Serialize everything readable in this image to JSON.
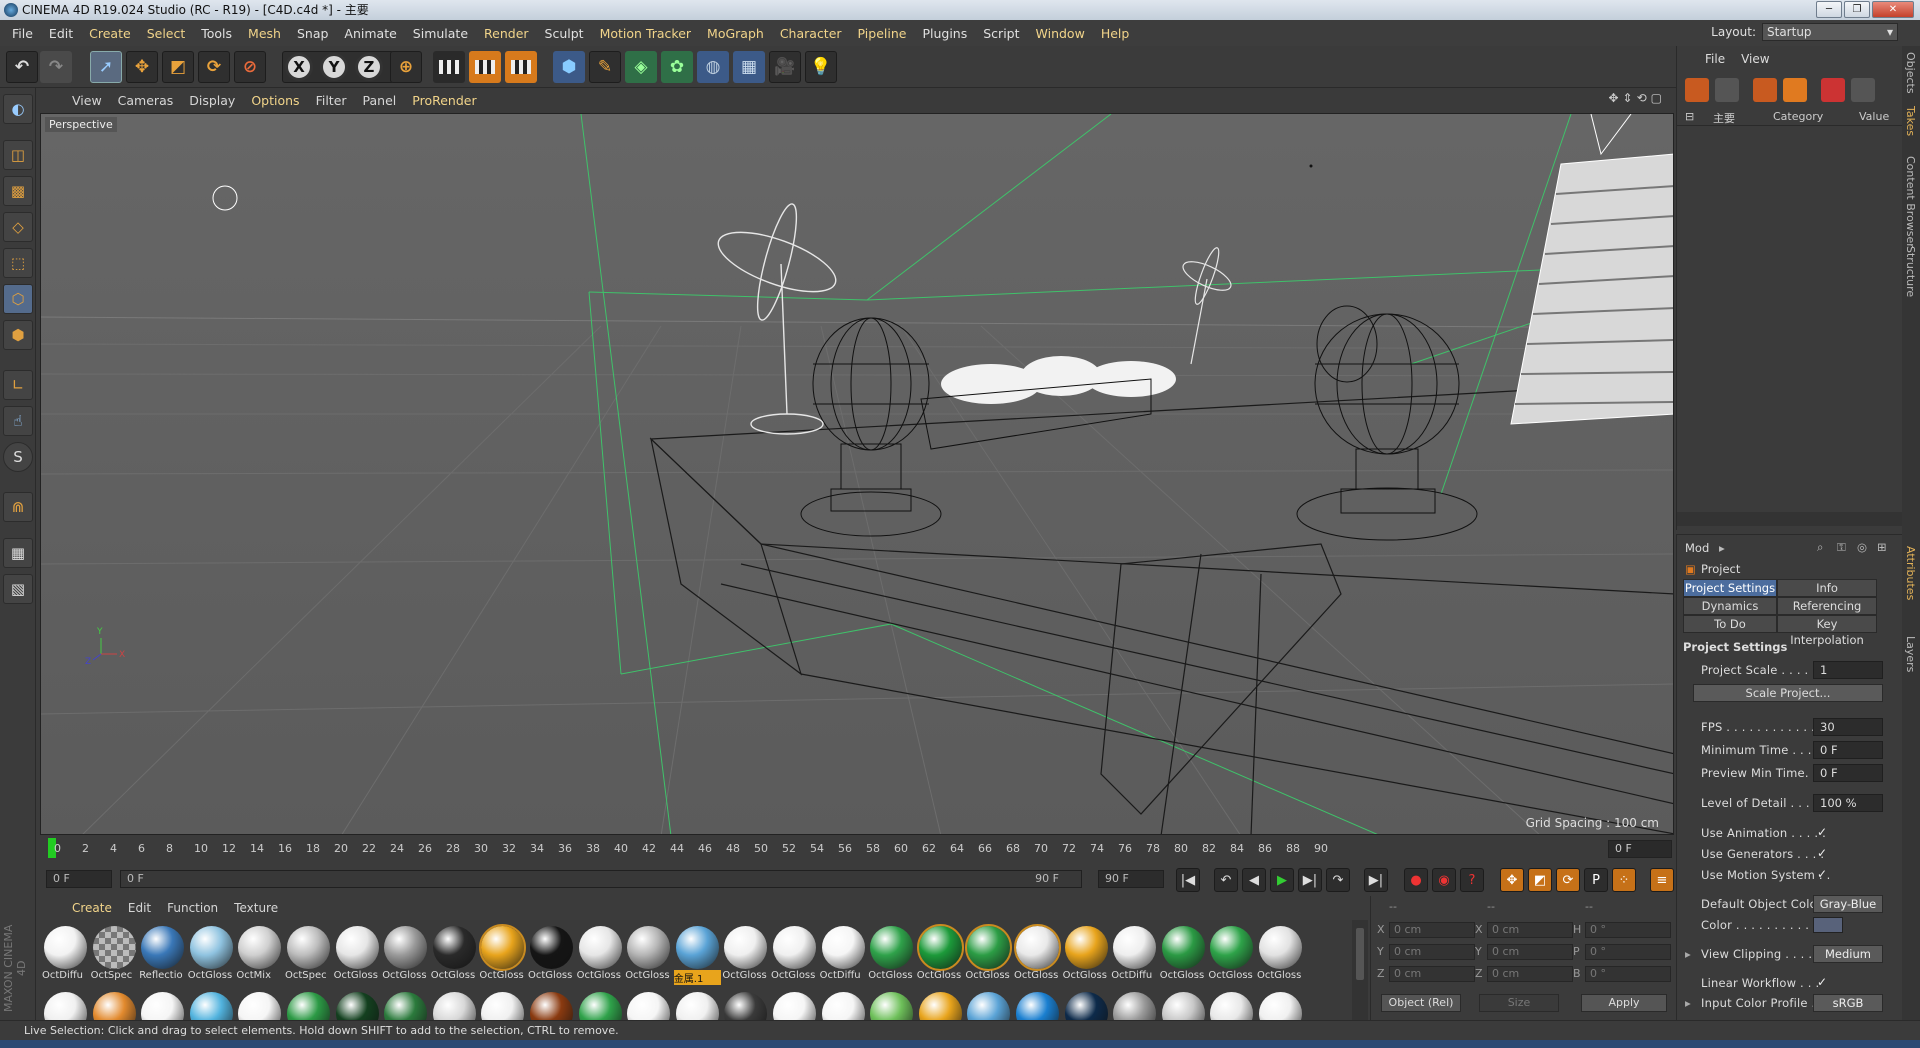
{
  "window": {
    "title": "CINEMA 4D R19.024 Studio (RC - R19) - [C4D.c4d *] - 主要"
  },
  "menu": [
    "File",
    "Edit",
    "Create",
    "Select",
    "Tools",
    "Mesh",
    "Snap",
    "Animate",
    "Simulate",
    "Render",
    "Sculpt",
    "Motion Tracker",
    "MoGraph",
    "Character",
    "Pipeline",
    "Plugins",
    "Script",
    "Window",
    "Help"
  ],
  "layout": {
    "label": "Layout:",
    "value": "Startup"
  },
  "viewport_menu": [
    "View",
    "Cameras",
    "Display",
    "Options",
    "Filter",
    "Panel",
    "ProRender"
  ],
  "viewport": {
    "camera": "Perspective",
    "grid_spacing": "Grid Spacing : 100 cm"
  },
  "timeline": {
    "ticks": [
      "0",
      "2",
      "4",
      "6",
      "8",
      "10",
      "12",
      "14",
      "16",
      "18",
      "20",
      "22",
      "24",
      "26",
      "28",
      "30",
      "32",
      "34",
      "36",
      "38",
      "40",
      "42",
      "44",
      "46",
      "48",
      "50",
      "52",
      "54",
      "56",
      "58",
      "60",
      "62",
      "64",
      "66",
      "68",
      "70",
      "72",
      "74",
      "76",
      "78",
      "80",
      "82",
      "84",
      "86",
      "88",
      "90"
    ],
    "current_frame": "0 F",
    "start": "0 F",
    "range_start": "0 F",
    "range_end": "90 F",
    "end": "90 F"
  },
  "material_menu": [
    "Create",
    "Edit",
    "Function",
    "Texture"
  ],
  "materials_row1": [
    {
      "name": "OctDiffu",
      "color": "#f2f2f2"
    },
    {
      "name": "OctSpec",
      "color": "checker"
    },
    {
      "name": "Reflectio",
      "color": "#3a78b8"
    },
    {
      "name": "OctGloss",
      "color": "#8fc3e0"
    },
    {
      "name": "OctMix",
      "color": "#cfcfcf"
    },
    {
      "name": "OctSpec",
      "color": "#bdbdbd"
    },
    {
      "name": "OctGloss",
      "color": "#e6e6e6"
    },
    {
      "name": "OctGloss",
      "color": "#9a9a9a"
    },
    {
      "name": "OctGloss",
      "color": "#2a2a2a"
    },
    {
      "name": "OctGloss",
      "color": "#e8a41c"
    },
    {
      "name": "OctGloss",
      "color": "#151515"
    },
    {
      "name": "OctGloss",
      "color": "#e6e6e6"
    },
    {
      "name": "OctGloss",
      "color": "#b5b5b5"
    },
    {
      "name": "金属.1",
      "color": "#5aa3d6",
      "tag": true
    },
    {
      "name": "OctGloss",
      "color": "#efefef"
    },
    {
      "name": "OctGloss",
      "color": "#f0f0f0"
    },
    {
      "name": "OctDiffu",
      "color": "#f5f5f5"
    },
    {
      "name": "OctGloss",
      "color": "#2fa24a"
    },
    {
      "name": "OctGloss",
      "color": "#1c9a3a"
    },
    {
      "name": "OctGloss",
      "color": "#2c9d45"
    },
    {
      "name": "OctGloss",
      "color": "#e9e9e9"
    },
    {
      "name": "OctGloss",
      "color": "#e8a41c"
    },
    {
      "name": "OctDiffu",
      "color": "#eeeeee"
    },
    {
      "name": "OctGloss",
      "color": "#2b9a44"
    },
    {
      "name": "OctGloss",
      "color": "#2ea349"
    },
    {
      "name": "OctGloss",
      "color": "#e2e2e2"
    }
  ],
  "materials_row2": [
    "#f0f0f0",
    "#e28a2e",
    "#f5f5f5",
    "#52b3de",
    "#f5f5f5",
    "#2c9a45",
    "#13401f",
    "#2b7a3c",
    "#d8d8d8",
    "#f0f0f0",
    "#8a3a10",
    "#2fa24a",
    "#f5f5f5",
    "#f0f0f0",
    "#3a3a3a",
    "#f5f5f5",
    "#f5f5f5",
    "#6ec05a",
    "#e8a41c",
    "#5aa3d6",
    "#1a7fd0",
    "#0d2a4a",
    "#9a9a9a",
    "#c8c8c8",
    "#e8e8e8",
    "#f0f0f0"
  ],
  "coords": {
    "header": [
      "--",
      "--",
      "--"
    ],
    "rows": [
      {
        "a": "X",
        "av": "0 cm",
        "b": "X",
        "bv": "0 cm",
        "c": "H",
        "cv": "0 °"
      },
      {
        "a": "Y",
        "av": "0 cm",
        "b": "Y",
        "bv": "0 cm",
        "c": "P",
        "cv": "0 °"
      },
      {
        "a": "Z",
        "av": "0 cm",
        "b": "Z",
        "bv": "0 cm",
        "c": "B",
        "cv": "0 °"
      }
    ],
    "mode": "Object (Rel)",
    "size": "Size",
    "apply": "Apply"
  },
  "status": "Live Selection: Click and drag to select elements. Hold down SHIFT to add to the selection, CTRL to remove.",
  "object_panel": {
    "menu": [
      "File",
      "View"
    ],
    "take": "主要",
    "col_category": "Category",
    "col_value": "Value"
  },
  "attributes": {
    "mode": "Mod",
    "object": "Project",
    "tabs": [
      "Project Settings",
      "Info",
      "Dynamics",
      "Referencing",
      "To Do",
      "Key Interpolation"
    ],
    "section": "Project Settings",
    "project_scale": {
      "label": "Project Scale . . . . . .",
      "value": "1"
    },
    "scale_button": "Scale Project...",
    "fps": {
      "label": "FPS . . . . . . . . . . . . . . .",
      "value": "30"
    },
    "min_time": {
      "label": "Minimum Time . . . .",
      "value": "0 F"
    },
    "preview_min": {
      "label": "Preview Min Time. . .",
      "value": "0 F"
    },
    "lod": {
      "label": "Level of Detail . . . . .",
      "value": "100 %"
    },
    "use_animation": {
      "label": "Use Animation . . . . .",
      "value": "✓"
    },
    "use_generators": {
      "label": "Use Generators . . . .",
      "value": "✓"
    },
    "use_motion": {
      "label": "Use Motion System . .",
      "value": "✓"
    },
    "default_color": {
      "label": "Default Object Color",
      "value": "Gray-Blue"
    },
    "color": {
      "label": "Color . . . . . . . . . . . ."
    },
    "view_clipping": {
      "label": "View Clipping . . . . .",
      "value": "Medium"
    },
    "linear_workflow": {
      "label": "Linear Workflow . . .",
      "value": "✓"
    },
    "input_profile": {
      "label": "Input Color Profile . .",
      "value": "sRGB"
    }
  },
  "side_tabs": [
    "Objects",
    "Takes",
    "Content Browser",
    "Structure",
    "Attributes",
    "Layers"
  ]
}
